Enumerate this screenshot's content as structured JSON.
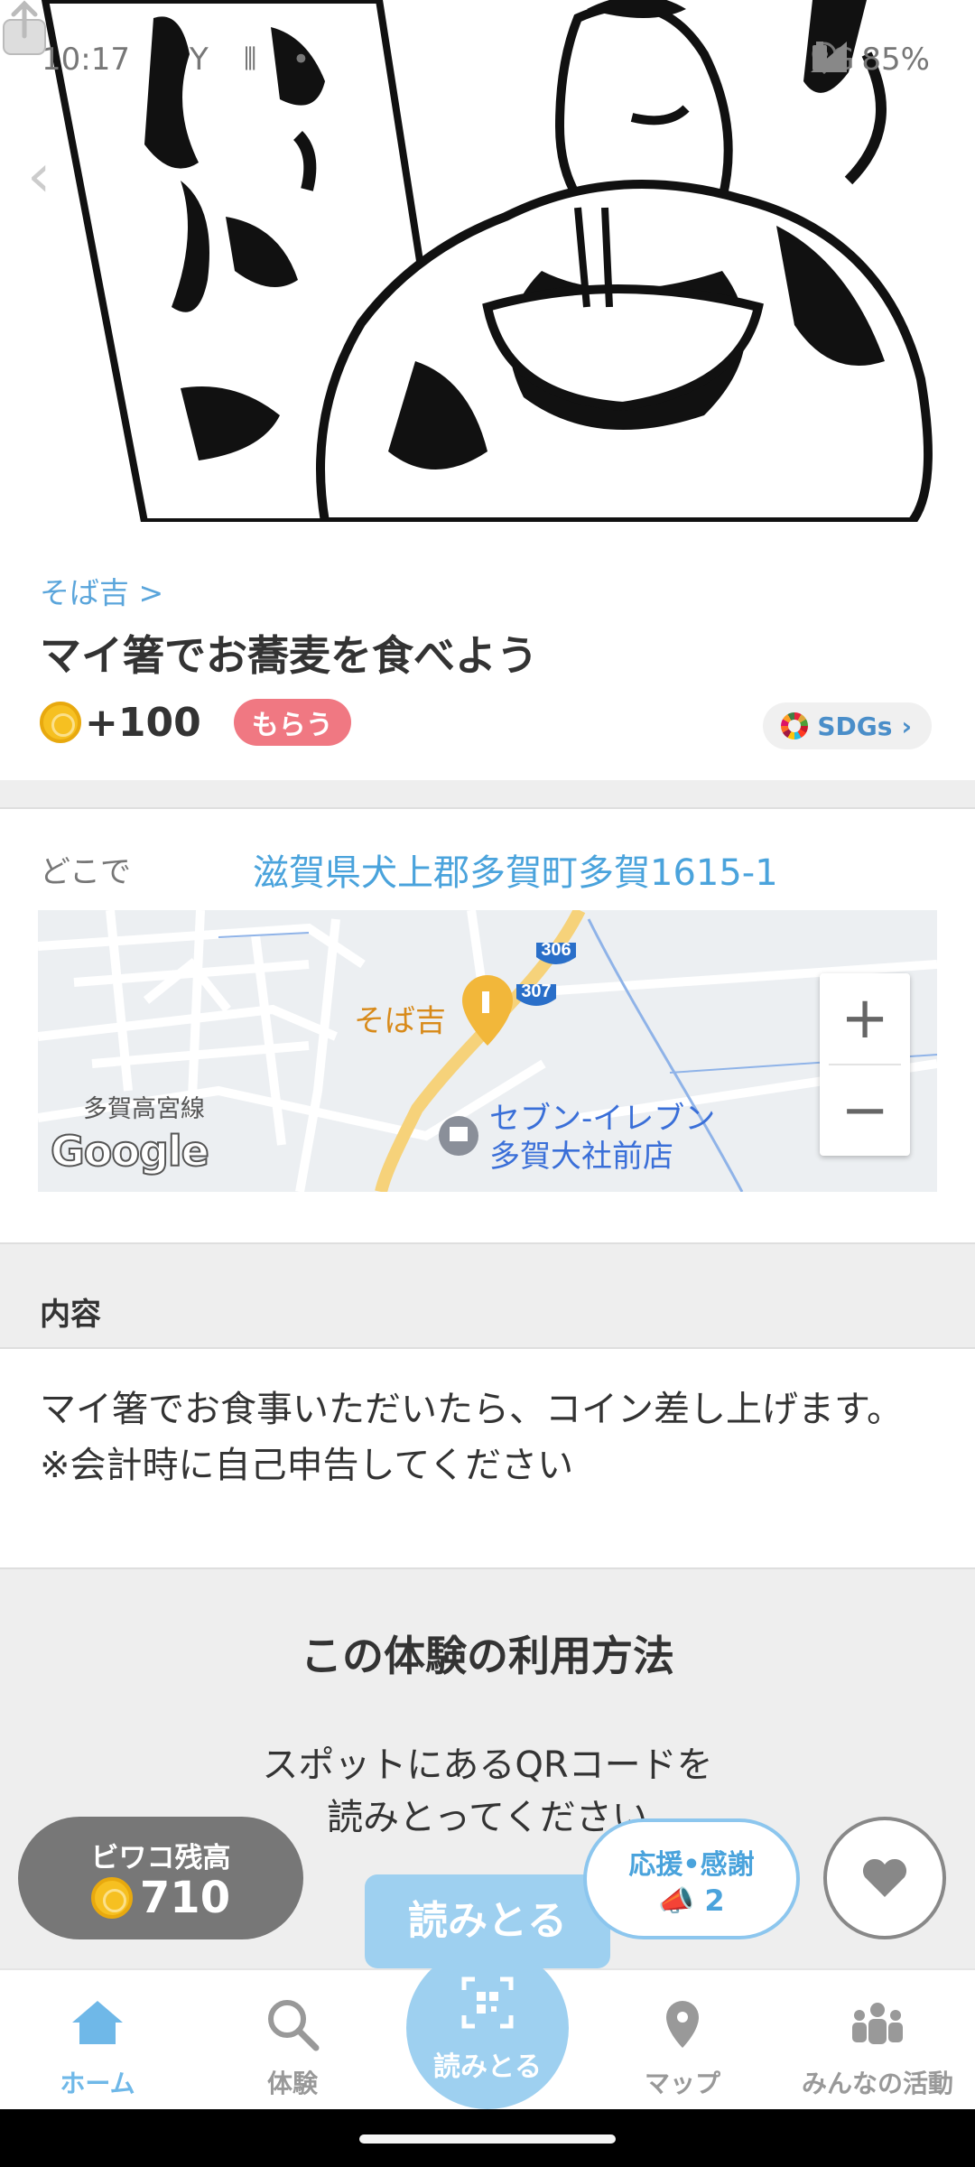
{
  "status_bar": {
    "time": "10:17",
    "network": "4G",
    "battery": "85%"
  },
  "hero": {
    "alt": "そば吉"
  },
  "breadcrumb": "そば吉 >",
  "title": "マイ箸でお蕎麦を食べよう",
  "reward": {
    "amount": "+100",
    "badge": "もらう"
  },
  "sdgs_label": "SDGs",
  "location": {
    "label": "どこで",
    "address": "滋賀県犬上郡多賀町多賀1615-1",
    "map": {
      "pin_label": "そば吉",
      "station_label": "多賀高宮線",
      "store_line1": "セブン-イレブン",
      "store_line2": "多賀大社前店",
      "route_306": "306",
      "route_307": "307",
      "google": "Google",
      "zoom_in": "+",
      "zoom_out": "−"
    }
  },
  "content": {
    "heading": "内容",
    "text_line1": "マイ箸でお食事いただいたら、コイン差し上げます。",
    "text_line2": "※会計時に自己申告してください"
  },
  "usage": {
    "title": "この体験の利用方法",
    "desc_line1": "スポットにあるQRコードを",
    "desc_line2": "読みとってください"
  },
  "balance": {
    "label": "ビワコ残高",
    "amount": "710"
  },
  "scan_button": "読みとる",
  "cheer": {
    "label": "応援•感謝",
    "count": "2"
  },
  "nav": {
    "home": "ホーム",
    "experience": "体験",
    "scan": "読みとる",
    "map": "マップ",
    "activity": "みんなの活動"
  },
  "colors": {
    "accent": "#4aa3dc",
    "badge": "#f07882",
    "scan": "#9ed0f0"
  }
}
